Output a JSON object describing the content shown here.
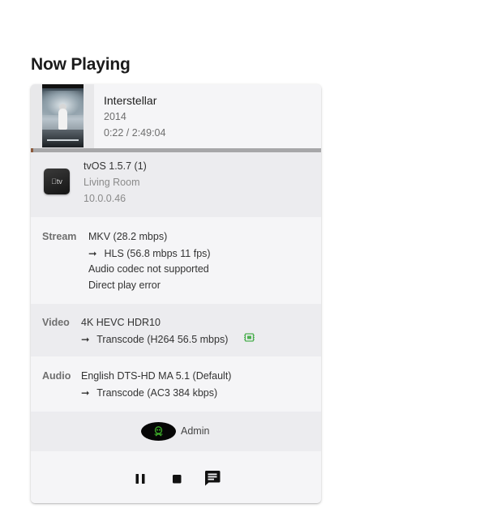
{
  "section": {
    "title": "Now Playing"
  },
  "media": {
    "title": "Interstellar",
    "year": "2014",
    "time": "0:22 / 2:49:04",
    "progress": 0.0022,
    "poster_icon": "movie-poster"
  },
  "player": {
    "name": "tvOS 1.5.7 (1)",
    "location": "Living Room",
    "ip": "10.0.0.46",
    "device_icon": "apple-tv-icon"
  },
  "stream": {
    "label": "Stream",
    "source": "MKV (28.2 mbps)",
    "arrow": "➞",
    "target": "HLS (56.8 mbps 11 fps)",
    "reason1": "Audio codec not supported",
    "reason2": "Direct play error"
  },
  "video": {
    "label": "Video",
    "source": "4K HEVC HDR10",
    "arrow": "➞",
    "target": "Transcode (H264 56.5 mbps)",
    "hw_icon": "hardware-acceleration-icon",
    "hw_color": "#4caf50"
  },
  "audio": {
    "label": "Audio",
    "source": "English DTS-HD MA 5.1 (Default)",
    "arrow": "➞",
    "target": "Transcode (AC3 384 kbps)"
  },
  "user": {
    "name": "Admin",
    "avatar_icon": "alien-avatar-icon",
    "avatar_color": "#3fae2a"
  },
  "controls": {
    "pause_icon": "pause-icon",
    "stop_icon": "stop-icon",
    "message_icon": "message-icon"
  },
  "colors": {
    "card_bg": "#f5f5f7",
    "alt_row_bg": "#ececef",
    "progress_track": "#a7a7a9",
    "progress_fill": "#8c5a3c"
  }
}
